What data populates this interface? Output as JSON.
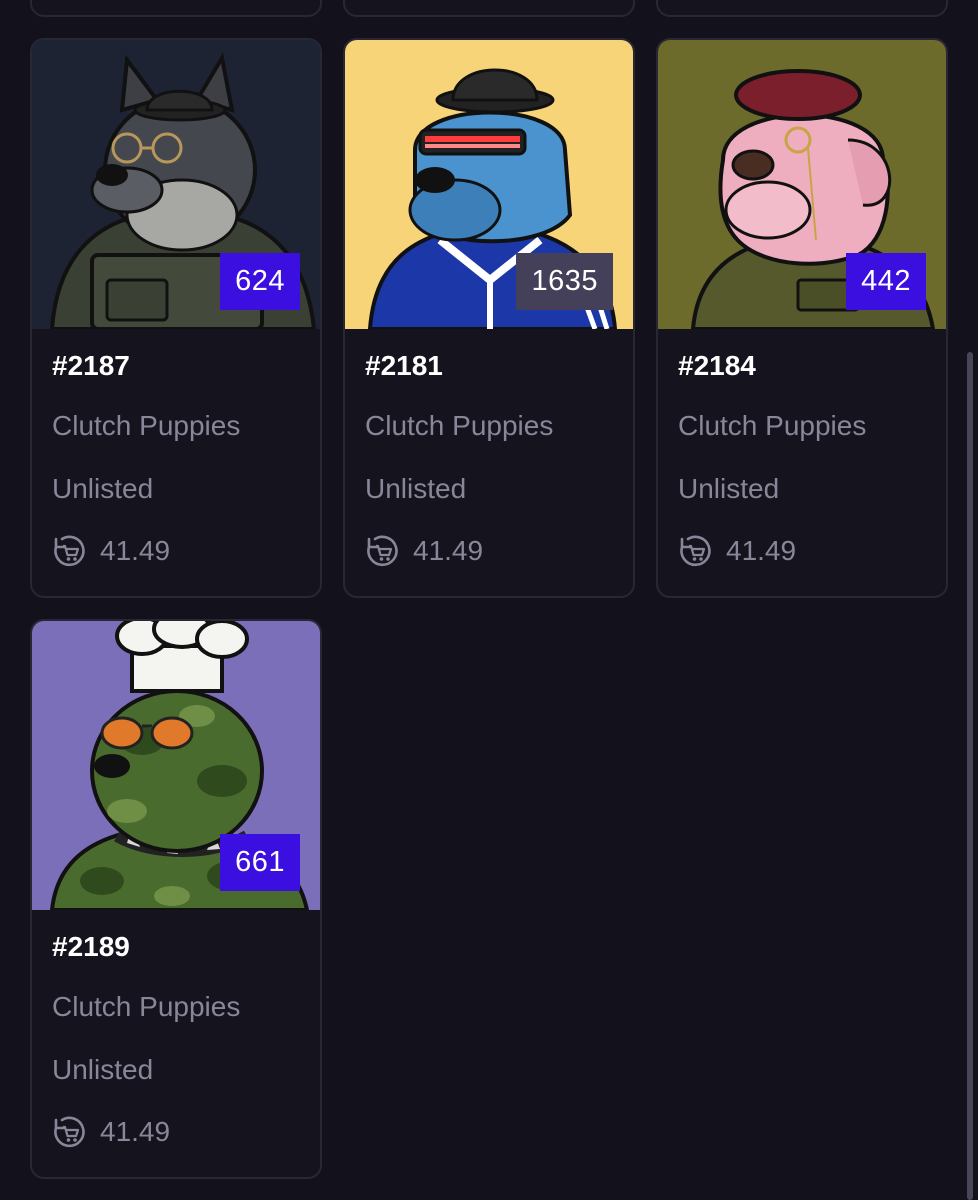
{
  "cards": [
    {
      "title": "#2187",
      "collection": "Clutch Puppies",
      "status": "Unlisted",
      "price": "41.49",
      "rank": "624",
      "rank_style": "blue",
      "background": "#1d2333",
      "art": "grey-wolf-dog-round-glasses-tactical-vest"
    },
    {
      "title": "#2181",
      "collection": "Clutch Puppies",
      "status": "Unlisted",
      "price": "41.49",
      "rank": "1635",
      "rank_style": "grey",
      "background": "#f7d478",
      "art": "blue-dog-bowler-hat-visor-track-jacket"
    },
    {
      "title": "#2184",
      "collection": "Clutch Puppies",
      "status": "Unlisted",
      "price": "41.49",
      "rank": "442",
      "rank_style": "blue",
      "background": "#6c6b2c",
      "art": "pink-dog-beret-monocle-army-jacket"
    },
    {
      "title": "#2189",
      "collection": "Clutch Puppies",
      "status": "Unlisted",
      "price": "41.49",
      "rank": "661",
      "rank_style": "blue",
      "background": "#7b6fb9",
      "art": "camo-poodle-chef-hat-aviators-spiked-collar"
    }
  ],
  "colors": {
    "page_background": "#13111c",
    "card_border": "#2a2735",
    "rank_blue": "#3a0fdf",
    "rank_grey": "#45405a",
    "muted_text": "#8a8699"
  },
  "icons": {
    "price": "cart-refresh-icon"
  }
}
